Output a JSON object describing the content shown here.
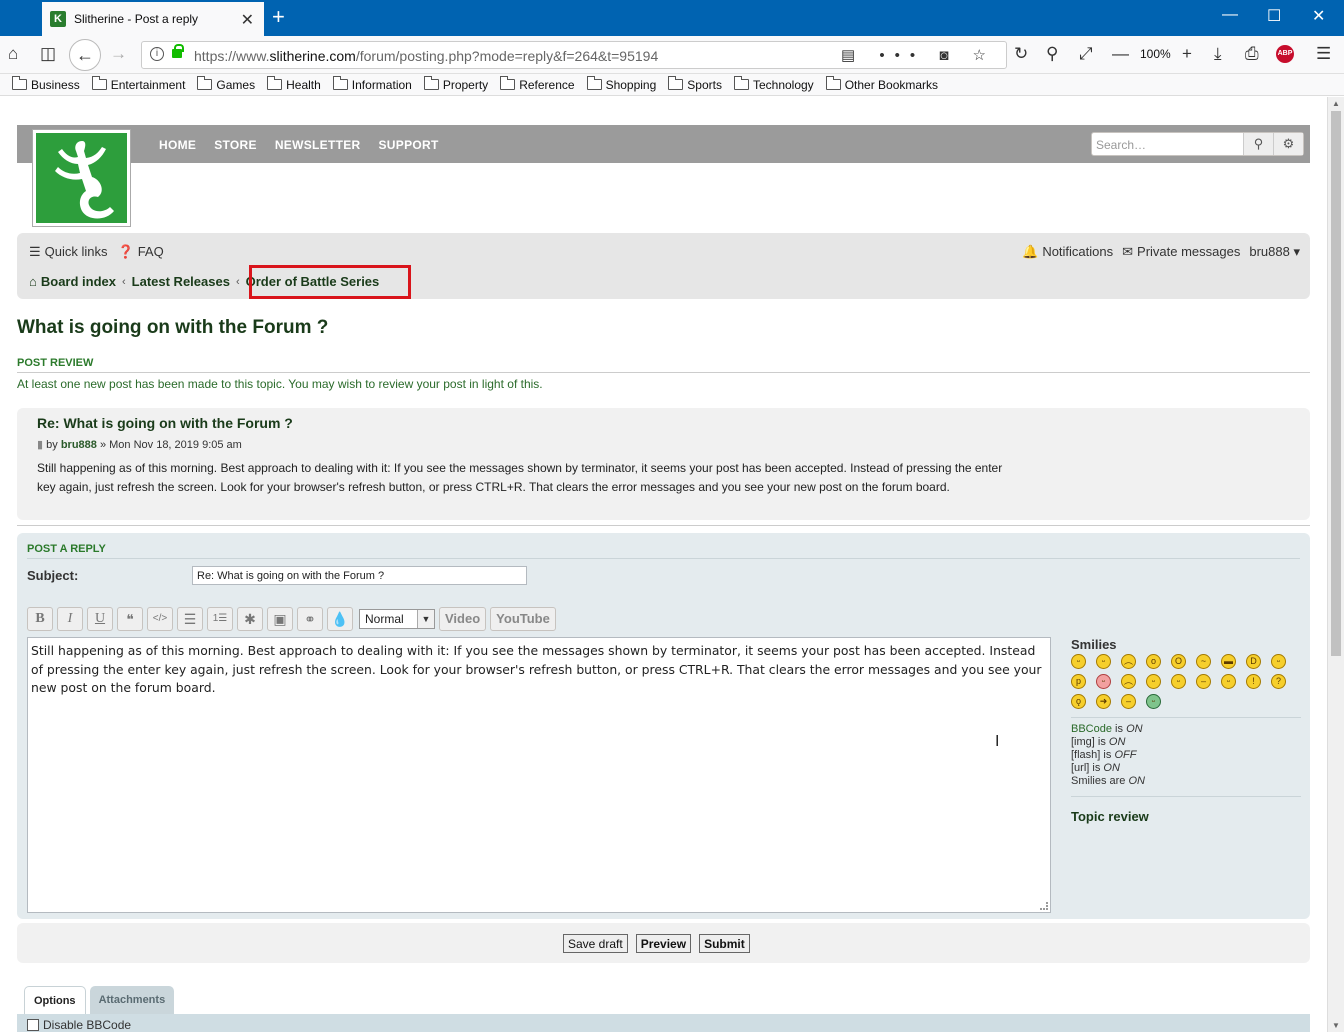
{
  "browser": {
    "tab_title": "Slitherine - Post a reply",
    "favicon_letter": "K",
    "url_prefix": "https://www.",
    "url_domain": "slitherine.com",
    "url_path": "/forum/posting.php?mode=reply&f=264&t=95194",
    "zoom": "100%",
    "abp_label": "ABP",
    "bookmarks": [
      "Business",
      "Entertainment",
      "Games",
      "Health",
      "Information",
      "Property",
      "Reference",
      "Shopping",
      "Sports",
      "Technology",
      "Other Bookmarks"
    ]
  },
  "site": {
    "nav": [
      "HOME",
      "STORE",
      "NEWSLETTER",
      "SUPPORT"
    ],
    "search_placeholder": "Search…",
    "quick_links": "Quick links",
    "faq": "FAQ",
    "notifications": "Notifications",
    "private_messages": "Private messages",
    "username": "bru888",
    "breadcrumbs": [
      "Board index",
      "Latest Releases",
      "Order of Battle Series"
    ]
  },
  "page": {
    "title": "What is going on with the Forum ?",
    "post_review_heading": "POST REVIEW",
    "post_review_note": "At least one new post has been made to this topic. You may wish to review your post in light of this."
  },
  "review_post": {
    "title": "Re: What is going on with the Forum ?",
    "by": "by",
    "author": "bru888",
    "date": "» Mon Nov 18, 2019 9:05 am",
    "body": "Still happening as of this morning. Best approach to dealing with it: If you see the messages shown by terminator, it seems your post has been accepted. Instead of pressing the enter key again, just refresh the screen. Look for your browser's refresh button, or press CTRL+R. That clears the error messages and you see your new post on the forum board."
  },
  "reply": {
    "heading": "POST A REPLY",
    "subject_label": "Subject:",
    "subject_value": "Re: What is going on with the Forum ?",
    "font_size": "Normal",
    "video_label": "Video",
    "youtube_label": "YouTube",
    "message": "Still happening as of this morning.  Best approach to dealing with it: If you see the messages shown by terminator, it seems your post has been accepted.  Instead of pressing the enter key again, just refresh the screen.  Look for your browser's refresh button, or press CTRL+R.  That clears the error messages and you see your new post on the forum board."
  },
  "sidebar": {
    "smilies_title": "Smilies",
    "bbcode_label": "BBCode",
    "bbcode_state": "ON",
    "img_label": "[img]",
    "img_state": "ON",
    "flash_label": "[flash]",
    "flash_state": "OFF",
    "url_label": "[url]",
    "url_state": "ON",
    "smilies_label": "Smilies are",
    "smilies_state": "ON",
    "is": "is",
    "topic_review": "Topic review"
  },
  "buttons": {
    "save_draft": "Save draft",
    "preview": "Preview",
    "submit": "Submit"
  },
  "options": {
    "tab_options": "Options",
    "tab_attachments": "Attachments",
    "disable_bbcode": "Disable BBCode"
  }
}
